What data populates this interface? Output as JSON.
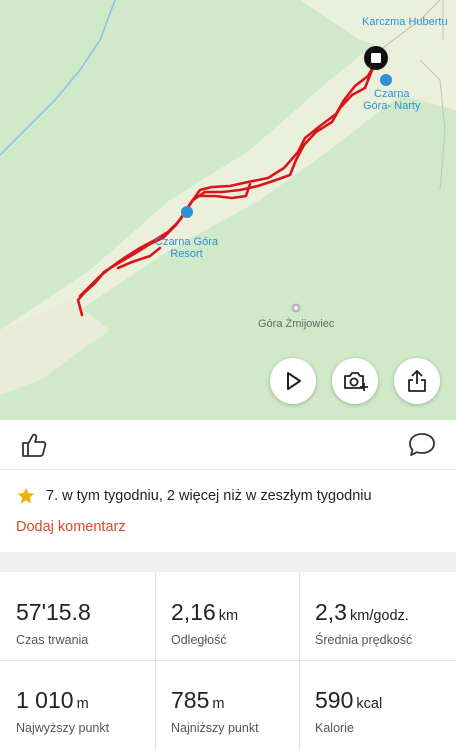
{
  "map": {
    "labels": {
      "top_place": "Karczma Hubertu",
      "poi_1_line1": "Czarna",
      "poi_1_line2": "Góra- Narty",
      "poi_2_line1": "Czarna Góra",
      "poi_2_line2": "Resort",
      "peak": "Góra Żmijowiec"
    },
    "buttons": {
      "play_icon": "play-icon",
      "camera_icon": "camera-add-icon",
      "share_icon": "share-icon"
    },
    "colors": {
      "route": "#d9141a",
      "meadow": "#ebf0dc",
      "forest": "#cfe9c9",
      "poi": "#2e8fd4"
    }
  },
  "action_bar": {
    "like_icon": "thumbs-up-icon",
    "comment_icon": "comment-bubble-icon"
  },
  "achievement": {
    "icon": "star-icon",
    "text": "7. w tym tygodniu, 2 więcej niż w zeszłym tygodniu",
    "add_comment": "Dodaj komentarz",
    "accent_color": "#d64b2a"
  },
  "stats": [
    {
      "value": "57'15.8",
      "unit": "",
      "label": "Czas trwania"
    },
    {
      "value": "2,16",
      "unit": "km",
      "label": "Odległość"
    },
    {
      "value": "2,3",
      "unit": "km/godz.",
      "label": "Średnia prędkość"
    },
    {
      "value": "1 010",
      "unit": "m",
      "label": "Najwyższy punkt"
    },
    {
      "value": "785",
      "unit": "m",
      "label": "Najniższy punkt"
    },
    {
      "value": "590",
      "unit": "kcal",
      "label": "Kalorie"
    }
  ]
}
